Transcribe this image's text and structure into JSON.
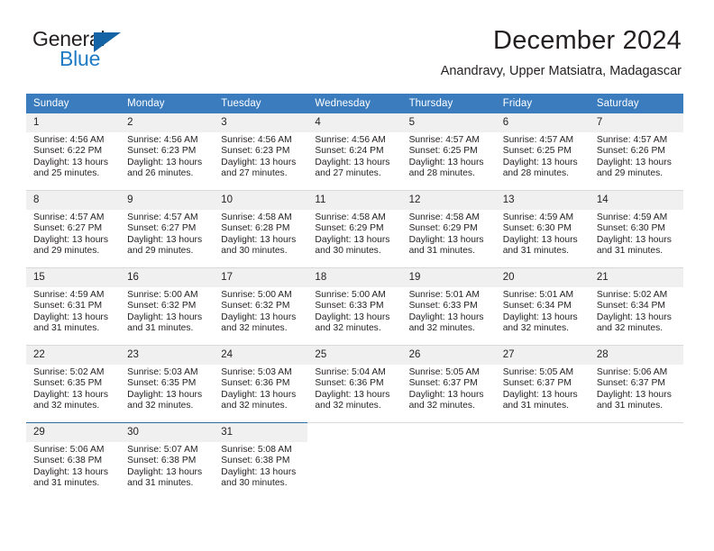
{
  "brand": {
    "word_one": "General",
    "word_two": "Blue",
    "accent_dark": "#1464a5",
    "accent_blue": "#1f7ac4"
  },
  "header": {
    "month_title": "December 2024",
    "location": "Anandravy, Upper Matsiatra, Madagascar"
  },
  "calendar": {
    "header_bg": "#3a7cbe",
    "daynum_bg": "#f0f0f0",
    "weekdays": [
      "Sunday",
      "Monday",
      "Tuesday",
      "Wednesday",
      "Thursday",
      "Friday",
      "Saturday"
    ],
    "weeks": [
      [
        {
          "day": "1",
          "sunrise": "Sunrise: 4:56 AM",
          "sunset": "Sunset: 6:22 PM",
          "daylight_1": "Daylight: 13 hours",
          "daylight_2": "and 25 minutes."
        },
        {
          "day": "2",
          "sunrise": "Sunrise: 4:56 AM",
          "sunset": "Sunset: 6:23 PM",
          "daylight_1": "Daylight: 13 hours",
          "daylight_2": "and 26 minutes."
        },
        {
          "day": "3",
          "sunrise": "Sunrise: 4:56 AM",
          "sunset": "Sunset: 6:23 PM",
          "daylight_1": "Daylight: 13 hours",
          "daylight_2": "and 27 minutes."
        },
        {
          "day": "4",
          "sunrise": "Sunrise: 4:56 AM",
          "sunset": "Sunset: 6:24 PM",
          "daylight_1": "Daylight: 13 hours",
          "daylight_2": "and 27 minutes."
        },
        {
          "day": "5",
          "sunrise": "Sunrise: 4:57 AM",
          "sunset": "Sunset: 6:25 PM",
          "daylight_1": "Daylight: 13 hours",
          "daylight_2": "and 28 minutes."
        },
        {
          "day": "6",
          "sunrise": "Sunrise: 4:57 AM",
          "sunset": "Sunset: 6:25 PM",
          "daylight_1": "Daylight: 13 hours",
          "daylight_2": "and 28 minutes."
        },
        {
          "day": "7",
          "sunrise": "Sunrise: 4:57 AM",
          "sunset": "Sunset: 6:26 PM",
          "daylight_1": "Daylight: 13 hours",
          "daylight_2": "and 29 minutes."
        }
      ],
      [
        {
          "day": "8",
          "sunrise": "Sunrise: 4:57 AM",
          "sunset": "Sunset: 6:27 PM",
          "daylight_1": "Daylight: 13 hours",
          "daylight_2": "and 29 minutes."
        },
        {
          "day": "9",
          "sunrise": "Sunrise: 4:57 AM",
          "sunset": "Sunset: 6:27 PM",
          "daylight_1": "Daylight: 13 hours",
          "daylight_2": "and 29 minutes."
        },
        {
          "day": "10",
          "sunrise": "Sunrise: 4:58 AM",
          "sunset": "Sunset: 6:28 PM",
          "daylight_1": "Daylight: 13 hours",
          "daylight_2": "and 30 minutes."
        },
        {
          "day": "11",
          "sunrise": "Sunrise: 4:58 AM",
          "sunset": "Sunset: 6:29 PM",
          "daylight_1": "Daylight: 13 hours",
          "daylight_2": "and 30 minutes."
        },
        {
          "day": "12",
          "sunrise": "Sunrise: 4:58 AM",
          "sunset": "Sunset: 6:29 PM",
          "daylight_1": "Daylight: 13 hours",
          "daylight_2": "and 31 minutes."
        },
        {
          "day": "13",
          "sunrise": "Sunrise: 4:59 AM",
          "sunset": "Sunset: 6:30 PM",
          "daylight_1": "Daylight: 13 hours",
          "daylight_2": "and 31 minutes."
        },
        {
          "day": "14",
          "sunrise": "Sunrise: 4:59 AM",
          "sunset": "Sunset: 6:30 PM",
          "daylight_1": "Daylight: 13 hours",
          "daylight_2": "and 31 minutes."
        }
      ],
      [
        {
          "day": "15",
          "sunrise": "Sunrise: 4:59 AM",
          "sunset": "Sunset: 6:31 PM",
          "daylight_1": "Daylight: 13 hours",
          "daylight_2": "and 31 minutes."
        },
        {
          "day": "16",
          "sunrise": "Sunrise: 5:00 AM",
          "sunset": "Sunset: 6:32 PM",
          "daylight_1": "Daylight: 13 hours",
          "daylight_2": "and 31 minutes."
        },
        {
          "day": "17",
          "sunrise": "Sunrise: 5:00 AM",
          "sunset": "Sunset: 6:32 PM",
          "daylight_1": "Daylight: 13 hours",
          "daylight_2": "and 32 minutes."
        },
        {
          "day": "18",
          "sunrise": "Sunrise: 5:00 AM",
          "sunset": "Sunset: 6:33 PM",
          "daylight_1": "Daylight: 13 hours",
          "daylight_2": "and 32 minutes."
        },
        {
          "day": "19",
          "sunrise": "Sunrise: 5:01 AM",
          "sunset": "Sunset: 6:33 PM",
          "daylight_1": "Daylight: 13 hours",
          "daylight_2": "and 32 minutes."
        },
        {
          "day": "20",
          "sunrise": "Sunrise: 5:01 AM",
          "sunset": "Sunset: 6:34 PM",
          "daylight_1": "Daylight: 13 hours",
          "daylight_2": "and 32 minutes."
        },
        {
          "day": "21",
          "sunrise": "Sunrise: 5:02 AM",
          "sunset": "Sunset: 6:34 PM",
          "daylight_1": "Daylight: 13 hours",
          "daylight_2": "and 32 minutes."
        }
      ],
      [
        {
          "day": "22",
          "sunrise": "Sunrise: 5:02 AM",
          "sunset": "Sunset: 6:35 PM",
          "daylight_1": "Daylight: 13 hours",
          "daylight_2": "and 32 minutes."
        },
        {
          "day": "23",
          "sunrise": "Sunrise: 5:03 AM",
          "sunset": "Sunset: 6:35 PM",
          "daylight_1": "Daylight: 13 hours",
          "daylight_2": "and 32 minutes."
        },
        {
          "day": "24",
          "sunrise": "Sunrise: 5:03 AM",
          "sunset": "Sunset: 6:36 PM",
          "daylight_1": "Daylight: 13 hours",
          "daylight_2": "and 32 minutes."
        },
        {
          "day": "25",
          "sunrise": "Sunrise: 5:04 AM",
          "sunset": "Sunset: 6:36 PM",
          "daylight_1": "Daylight: 13 hours",
          "daylight_2": "and 32 minutes."
        },
        {
          "day": "26",
          "sunrise": "Sunrise: 5:05 AM",
          "sunset": "Sunset: 6:37 PM",
          "daylight_1": "Daylight: 13 hours",
          "daylight_2": "and 32 minutes."
        },
        {
          "day": "27",
          "sunrise": "Sunrise: 5:05 AM",
          "sunset": "Sunset: 6:37 PM",
          "daylight_1": "Daylight: 13 hours",
          "daylight_2": "and 31 minutes."
        },
        {
          "day": "28",
          "sunrise": "Sunrise: 5:06 AM",
          "sunset": "Sunset: 6:37 PM",
          "daylight_1": "Daylight: 13 hours",
          "daylight_2": "and 31 minutes."
        }
      ],
      [
        {
          "day": "29",
          "sunrise": "Sunrise: 5:06 AM",
          "sunset": "Sunset: 6:38 PM",
          "daylight_1": "Daylight: 13 hours",
          "daylight_2": "and 31 minutes."
        },
        {
          "day": "30",
          "sunrise": "Sunrise: 5:07 AM",
          "sunset": "Sunset: 6:38 PM",
          "daylight_1": "Daylight: 13 hours",
          "daylight_2": "and 31 minutes."
        },
        {
          "day": "31",
          "sunrise": "Sunrise: 5:08 AM",
          "sunset": "Sunset: 6:38 PM",
          "daylight_1": "Daylight: 13 hours",
          "daylight_2": "and 30 minutes."
        },
        {
          "day": "",
          "sunrise": "",
          "sunset": "",
          "daylight_1": "",
          "daylight_2": ""
        },
        {
          "day": "",
          "sunrise": "",
          "sunset": "",
          "daylight_1": "",
          "daylight_2": ""
        },
        {
          "day": "",
          "sunrise": "",
          "sunset": "",
          "daylight_1": "",
          "daylight_2": ""
        },
        {
          "day": "",
          "sunrise": "",
          "sunset": "",
          "daylight_1": "",
          "daylight_2": ""
        }
      ]
    ]
  }
}
